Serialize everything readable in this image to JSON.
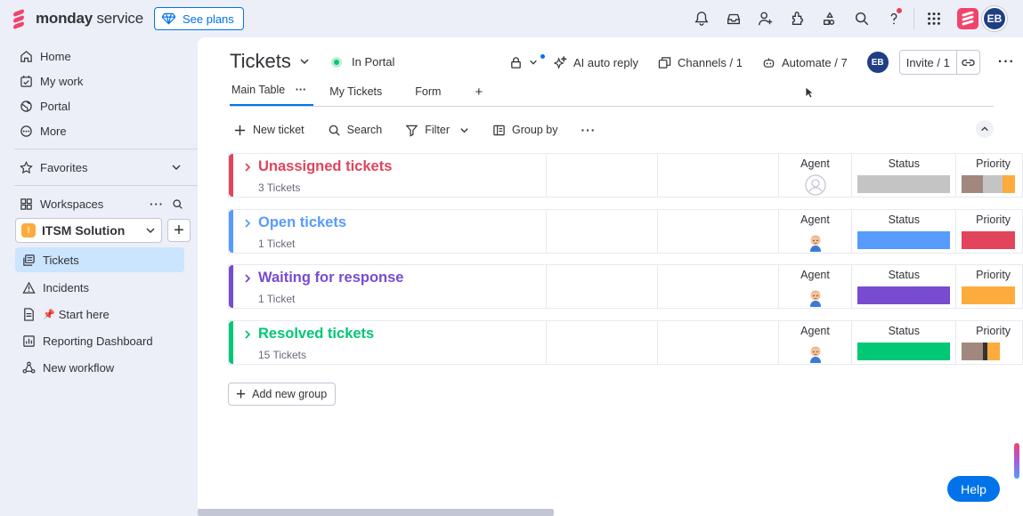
{
  "topbar": {
    "brand_bold": "monday",
    "brand_rest": " service",
    "see_plans": "See plans",
    "avatar": "EB"
  },
  "sidebar": {
    "nav": [
      {
        "label": "Home"
      },
      {
        "label": "My work"
      },
      {
        "label": "Portal"
      },
      {
        "label": "More"
      }
    ],
    "favorites": "Favorites",
    "workspaces": "Workspaces",
    "workspace_badge": "I",
    "workspace_name": "ITSM Solution",
    "items": [
      {
        "label": "Tickets"
      },
      {
        "label": "Incidents"
      },
      {
        "label": "Start here"
      },
      {
        "label": "Reporting Dashboard"
      },
      {
        "label": "New workflow"
      }
    ]
  },
  "board": {
    "title": "Tickets",
    "portal_status": "In Portal",
    "ai_auto_reply": "AI auto reply",
    "channels": "Channels / 1",
    "automate": "Automate / 7",
    "avatar": "EB",
    "invite": "Invite / 1",
    "tabs": [
      {
        "label": "Main Table"
      },
      {
        "label": "My Tickets"
      },
      {
        "label": "Form"
      }
    ],
    "toolbar": {
      "new_ticket": "New ticket",
      "search": "Search",
      "filter": "Filter",
      "group_by": "Group by"
    },
    "columns": {
      "agent": "Agent",
      "status": "Status",
      "priority": "Priority"
    },
    "groups": [
      {
        "title": "Unassigned tickets",
        "count": "3 Tickets",
        "color": "#e2445c",
        "status_color": "#c4c4c4",
        "priority": [
          "#a1887f",
          "#c4c4c4",
          "#fdab3d"
        ],
        "agent": "empty"
      },
      {
        "title": "Open tickets",
        "count": "1 Ticket",
        "color": "#579bfc",
        "status_color": "#579bfc",
        "priority": [
          "#e2445c"
        ],
        "agent": "person"
      },
      {
        "title": "Waiting for response",
        "count": "1 Ticket",
        "color": "#784bd1",
        "status_color": "#784bd1",
        "priority": [
          "#fdab3d"
        ],
        "agent": "person"
      },
      {
        "title": "Resolved tickets",
        "count": "15 Tickets",
        "color": "#00c875",
        "status_color": "#00c875",
        "priority": [
          "#a1887f",
          "#333333",
          "#fdab3d"
        ],
        "agent": "person"
      }
    ],
    "add_group": "Add new group",
    "help": "Help"
  },
  "colors": {
    "accent": "#0073ea",
    "brand": "#f0446c"
  }
}
